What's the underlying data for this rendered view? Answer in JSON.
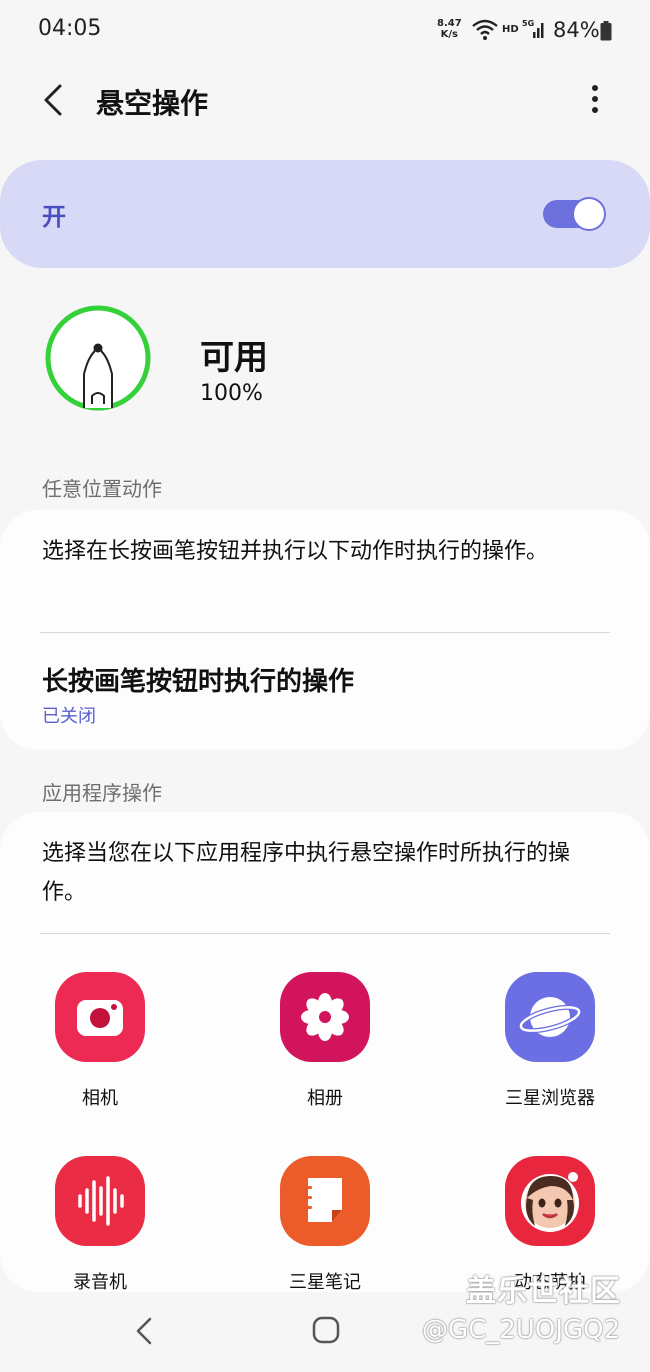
{
  "status_bar": {
    "time": "04:05",
    "net_speed_value": "8.47",
    "net_speed_unit": "K/s",
    "hd_label": "HD",
    "battery_pct": "84%"
  },
  "header": {
    "title": "悬空操作"
  },
  "master_switch": {
    "label": "开",
    "state": "on",
    "accent_color": "#6d71dd"
  },
  "pen_status": {
    "title": "可用",
    "battery": "100%"
  },
  "section_anywhere": {
    "header": "任意位置动作",
    "description": "选择在长按画笔按钮并执行以下动作时执行的操作。",
    "item_title": "长按画笔按钮时执行的操作",
    "item_status": "已关闭"
  },
  "section_apps": {
    "header": "应用程序操作",
    "description": "选择当您在以下应用程序中执行悬空操作时所执行的操作。",
    "apps": [
      {
        "name": "相机",
        "icon": "camera-icon"
      },
      {
        "name": "相册",
        "icon": "gallery-icon"
      },
      {
        "name": "三星浏览器",
        "icon": "browser-icon"
      },
      {
        "name": "录音机",
        "icon": "voice-recorder-icon"
      },
      {
        "name": "三星笔记",
        "icon": "notes-icon"
      },
      {
        "name": "动态萌拍",
        "icon": "ar-emoji-icon"
      }
    ]
  },
  "watermark": {
    "line1": "盖乐世社区",
    "line2": "@GC_2UOJGQ2"
  }
}
